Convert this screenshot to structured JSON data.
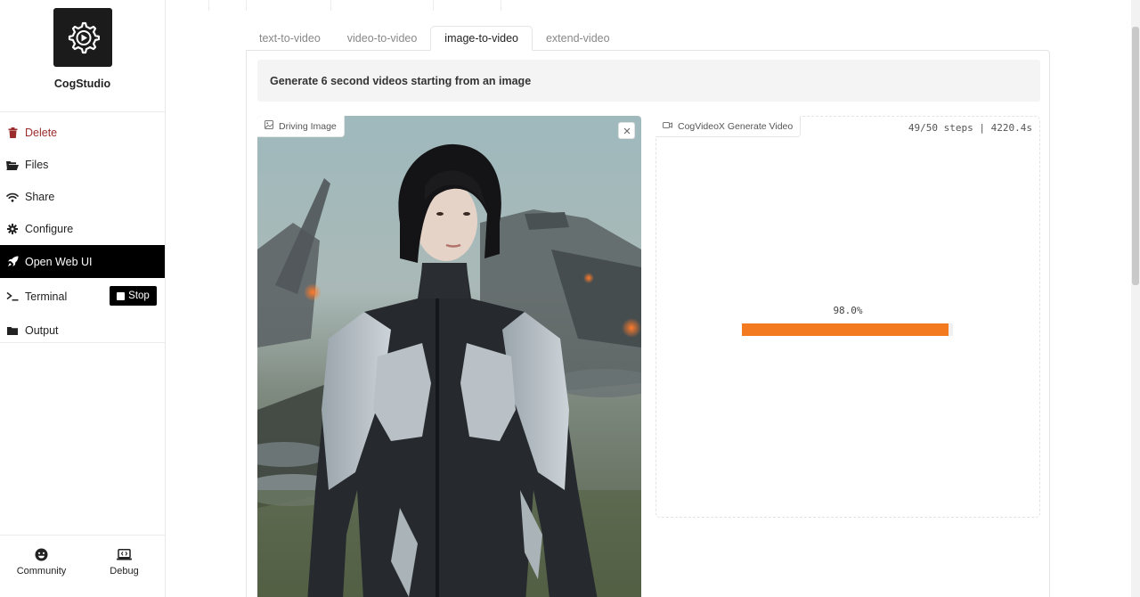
{
  "app": {
    "name": "CogStudio"
  },
  "sidebar": {
    "items": [
      {
        "label": "Delete",
        "icon": "trash-icon"
      },
      {
        "label": "Files",
        "icon": "folder-open-icon"
      },
      {
        "label": "Share",
        "icon": "wifi-icon"
      },
      {
        "label": "Configure",
        "icon": "gear-icon"
      },
      {
        "label": "Open Web UI",
        "icon": "rocket-icon",
        "active": true
      },
      {
        "label": "Terminal",
        "icon": "terminal-icon",
        "stop_label": "Stop"
      },
      {
        "label": "Output",
        "icon": "folder-icon"
      }
    ],
    "bottom": [
      {
        "label": "Community",
        "icon": "smiley-icon"
      },
      {
        "label": "Debug",
        "icon": "laptop-code-icon"
      }
    ]
  },
  "tabs": [
    {
      "label": "text-to-video"
    },
    {
      "label": "video-to-video"
    },
    {
      "label": "image-to-video",
      "selected": true
    },
    {
      "label": "extend-video"
    }
  ],
  "description": "Generate 6 second videos starting from an image",
  "input_image": {
    "label": "Driving Image"
  },
  "output_video": {
    "label": "CogVideoX Generate Video",
    "steps": "49/50 steps | 4220.4s",
    "progress_text": "98.0%",
    "progress": 0.98
  },
  "colors": {
    "accent": "#f47a1f",
    "active_bg": "#000000",
    "delete": "#9b2c2c"
  }
}
